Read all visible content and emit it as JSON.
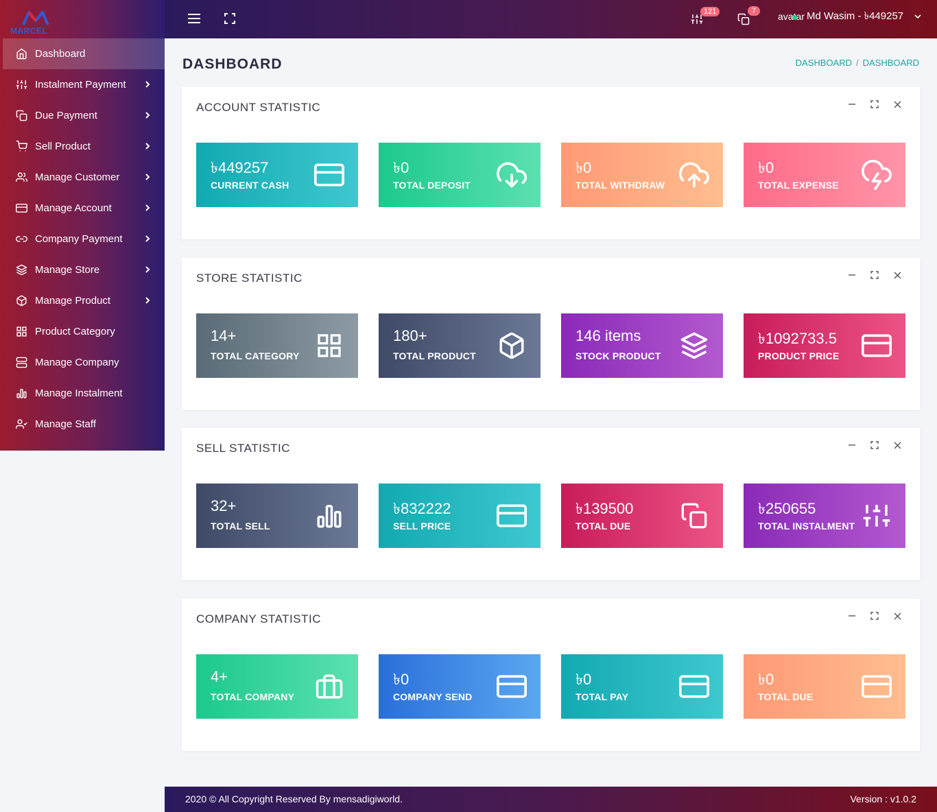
{
  "brand": {
    "logo_text": "MARCEL"
  },
  "sidebar": {
    "items": [
      {
        "label": "Dashboard",
        "icon": "home-icon",
        "active": true,
        "has_submenu": false
      },
      {
        "label": "Instalment Payment",
        "icon": "sliders-icon",
        "has_submenu": true
      },
      {
        "label": "Due Payment",
        "icon": "copy-icon",
        "has_submenu": true
      },
      {
        "label": "Sell Product",
        "icon": "cart-icon",
        "has_submenu": true
      },
      {
        "label": "Manage Customer",
        "icon": "users-icon",
        "has_submenu": true
      },
      {
        "label": "Manage Account",
        "icon": "credit-card-icon",
        "has_submenu": true
      },
      {
        "label": "Company Payment",
        "icon": "link-icon",
        "has_submenu": true
      },
      {
        "label": "Manage Store",
        "icon": "layers-icon",
        "has_submenu": true
      },
      {
        "label": "Manage Product",
        "icon": "box-icon",
        "has_submenu": true
      },
      {
        "label": "Product Category",
        "icon": "grid-icon",
        "has_submenu": false
      },
      {
        "label": "Manage Company",
        "icon": "server-icon",
        "has_submenu": false
      },
      {
        "label": "Manage Instalment",
        "icon": "bar-chart-icon",
        "has_submenu": false
      },
      {
        "label": "Manage Staff",
        "icon": "user-check-icon",
        "has_submenu": false
      }
    ]
  },
  "topbar": {
    "instalment_badge": "121",
    "due_badge": "7",
    "avatar_alt": "avatar",
    "user_label": "Md Wasim - ৳449257"
  },
  "page": {
    "title": "DASHBOARD",
    "breadcrumb": [
      "DASHBOARD",
      "DASHBOARD"
    ]
  },
  "panels": [
    {
      "title": "ACCOUNT STATISTIC",
      "cards": [
        {
          "value": "৳449257",
          "label": "CURRENT CASH",
          "icon": "credit-card-icon",
          "color": "#13a9b1"
        },
        {
          "value": "৳0",
          "label": "TOTAL DEPOSIT",
          "icon": "download-cloud-icon",
          "color": "#1cc98d"
        },
        {
          "value": "৳0",
          "label": "TOTAL WITHDRAW",
          "icon": "upload-cloud-icon",
          "color": "#ff9a75"
        },
        {
          "value": "৳0",
          "label": "TOTAL EXPENSE",
          "icon": "cloud-lightning-icon",
          "color": "#ff6b88"
        }
      ]
    },
    {
      "title": "STORE STATISTIC",
      "cards": [
        {
          "value": "14+",
          "label": "TOTAL CATEGORY",
          "icon": "grid-icon",
          "color": "#5a6a76"
        },
        {
          "value": "180+",
          "label": "TOTAL PRODUCT",
          "icon": "box-icon",
          "color": "#3e4a66"
        },
        {
          "value": "146 items",
          "label": "STOCK PRODUCT",
          "icon": "layers-icon",
          "color": "#8a2ab8"
        },
        {
          "value": "৳1092733.5",
          "label": "PRODUCT PRICE",
          "icon": "credit-card-icon",
          "color": "#c81c5b"
        }
      ]
    },
    {
      "title": "SELL STATISTIC",
      "cards": [
        {
          "value": "32+",
          "label": "TOTAL SELL",
          "icon": "bar-chart-icon",
          "color": "#3e4a66"
        },
        {
          "value": "৳832222",
          "label": "SELL PRICE",
          "icon": "credit-card-icon",
          "color": "#13a9b1"
        },
        {
          "value": "৳139500",
          "label": "TOTAL DUE",
          "icon": "copy-icon",
          "color": "#c81c5b"
        },
        {
          "value": "৳250655",
          "label": "TOTAL INSTALMENT",
          "icon": "sliders-icon",
          "color": "#8a2ab8"
        }
      ]
    },
    {
      "title": "COMPANY STATISTIC",
      "cards": [
        {
          "value": "4+",
          "label": "TOTAL COMPANY",
          "icon": "briefcase-icon",
          "color": "#1cc98d"
        },
        {
          "value": "৳0",
          "label": "COMPANY SEND",
          "icon": "credit-card-icon",
          "color": "#2a6fd9"
        },
        {
          "value": "৳0",
          "label": "TOTAL PAY",
          "icon": "credit-card-icon",
          "color": "#13a9b1"
        },
        {
          "value": "৳0",
          "label": "TOTAL DUE",
          "icon": "credit-card-icon",
          "color": "#ff9a75"
        }
      ]
    }
  ],
  "footer": {
    "copyright": "2020 © All Copyright Reserved By mensadigiworld.",
    "version": "Version : v1.0.2"
  }
}
